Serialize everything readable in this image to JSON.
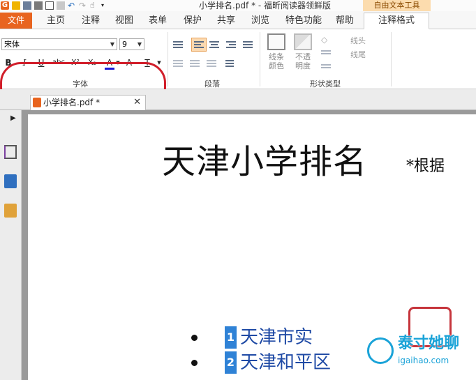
{
  "window": {
    "title": "小学排名.pdf * - 福昕阅读器领鲜版",
    "context_tool": "自由文本工具",
    "accent": "#e8641f"
  },
  "tabs": [
    {
      "label": "文件"
    },
    {
      "label": "主页"
    },
    {
      "label": "注释"
    },
    {
      "label": "视图"
    },
    {
      "label": "表单"
    },
    {
      "label": "保护"
    },
    {
      "label": "共享"
    },
    {
      "label": "浏览"
    },
    {
      "label": "特色功能"
    },
    {
      "label": "帮助"
    },
    {
      "label": "注释格式"
    }
  ],
  "ribbon": {
    "font": {
      "label": "字体",
      "family": "宋体",
      "size": "9",
      "buttons": {
        "bold": "B",
        "italic": "I",
        "underline": "U",
        "strikethrough": "abc",
        "superscript": "X²",
        "subscript": "X₂",
        "font_color": "A",
        "char_spacing": "A",
        "text_style": "T"
      },
      "font_color_value": "#1b1bd6"
    },
    "paragraph": {
      "label": "段落"
    },
    "shape": {
      "label": "形状类型",
      "line_color": "线条\n颜色",
      "opacity": "不透\n明度",
      "line_start": "线头",
      "line_end": "线尾"
    }
  },
  "document_tab": {
    "label": "小学排名.pdf *"
  },
  "document": {
    "title": "天津小学排名",
    "note": "*根据",
    "items": [
      {
        "number": "1",
        "text": "天津市实"
      },
      {
        "number": "2",
        "text": "天津和平区"
      }
    ]
  },
  "watermark": {
    "main": "泰寸她聊",
    "url": "igaihao.com"
  }
}
